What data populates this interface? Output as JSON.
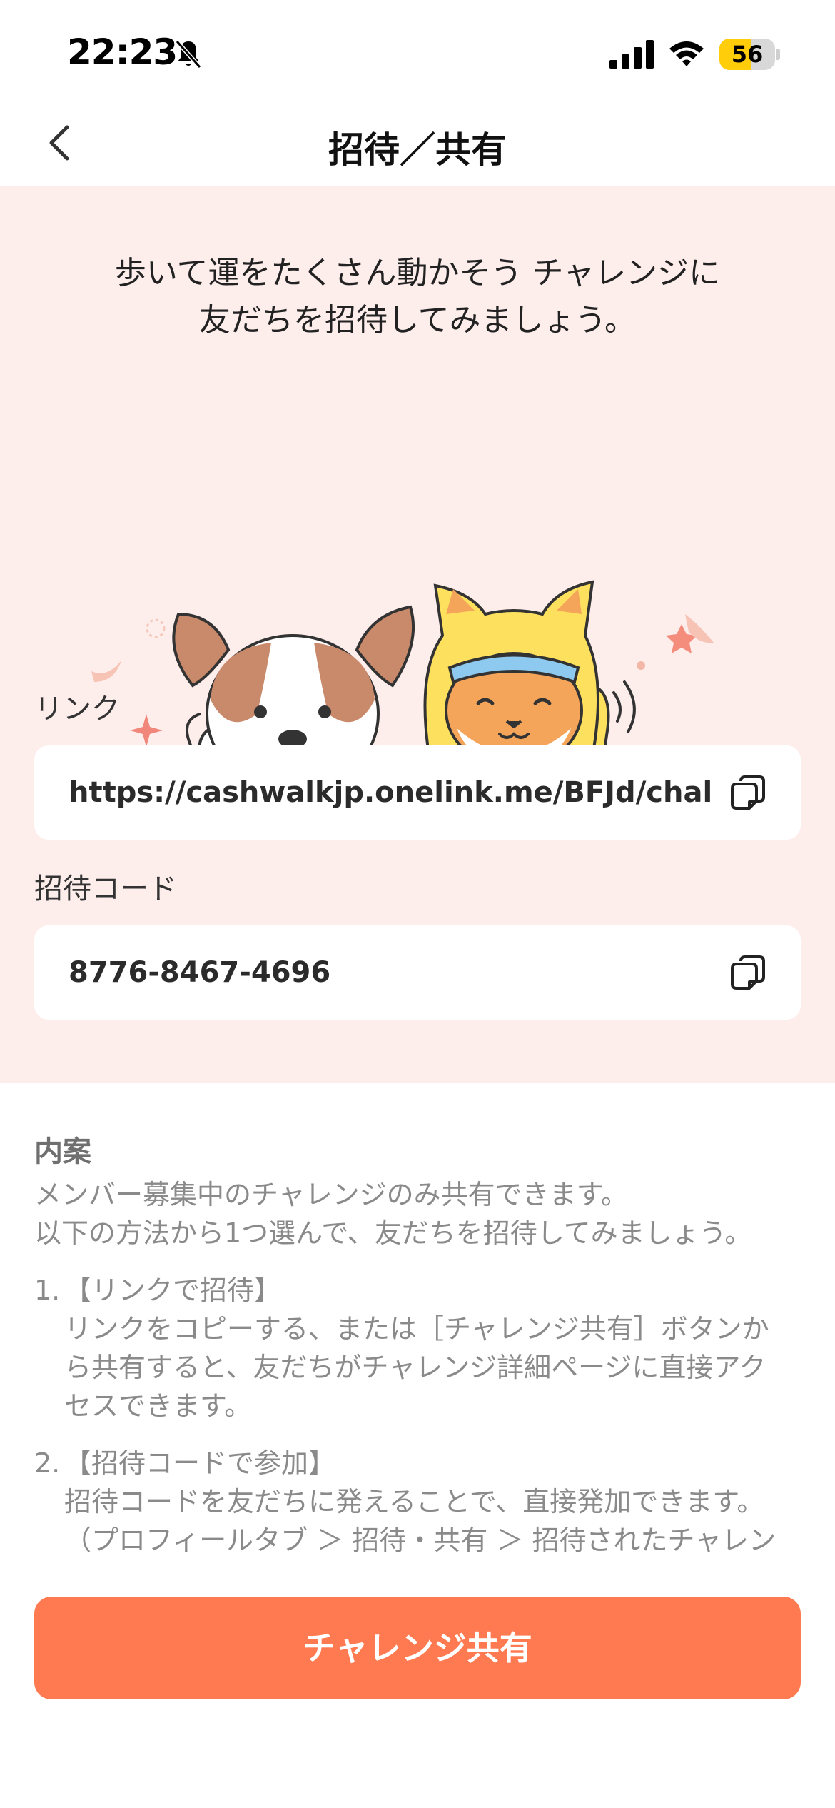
{
  "status_bar": {
    "time": "22:23",
    "battery": "56",
    "battery_percent": 56
  },
  "nav": {
    "title": "招待／共有"
  },
  "hero": {
    "message_line1": "歩いて運をたくさん動かそう チャレンジに",
    "message_line2": "友だちを招待してみましょう。"
  },
  "link_field": {
    "label": "リンク",
    "value": "https://cashwalkjp.onelink.me/BFJd/challe"
  },
  "code_field": {
    "label": "招待コード",
    "value": "8776-8467-4696"
  },
  "info": {
    "title": "内案",
    "intro_line1": "メンバー募集中のチャレンジのみ共有できます。",
    "intro_line2": "以下の方法から1つ選んで、友だちを招待してみましょう。",
    "item1_num": "1.",
    "item1_title": "【リンクで招待】",
    "item1_line1": "リンクをコピーする、または［チャレンジ共有］ボタンか",
    "item1_line2": "ら共有すると、友だちがチャレンジ詳細ページに直接アク",
    "item1_line3": "セスできます。",
    "item2_num": "2.",
    "item2_title": "【招待コードで参加】",
    "item2_line1": "招待コードを友だちに発えることで、直接発加できます。",
    "item2_line2": "（プロフィールタブ ＞ 招待・共有 ＞ 招待されたチャレン"
  },
  "cta": {
    "label": "チャレンジ共有"
  },
  "colors": {
    "accent": "#ff7a50",
    "hero_bg": "#fdeeec",
    "battery": "#ffcd0a",
    "dog_brown": "#c98a6b",
    "cat_yellow": "#fde15e"
  },
  "icons": {
    "back": "chevron-left-icon",
    "copy": "copy-icon",
    "bell": "bell-slash-icon",
    "signal": "cellular-signal-icon",
    "wifi": "wifi-icon"
  }
}
